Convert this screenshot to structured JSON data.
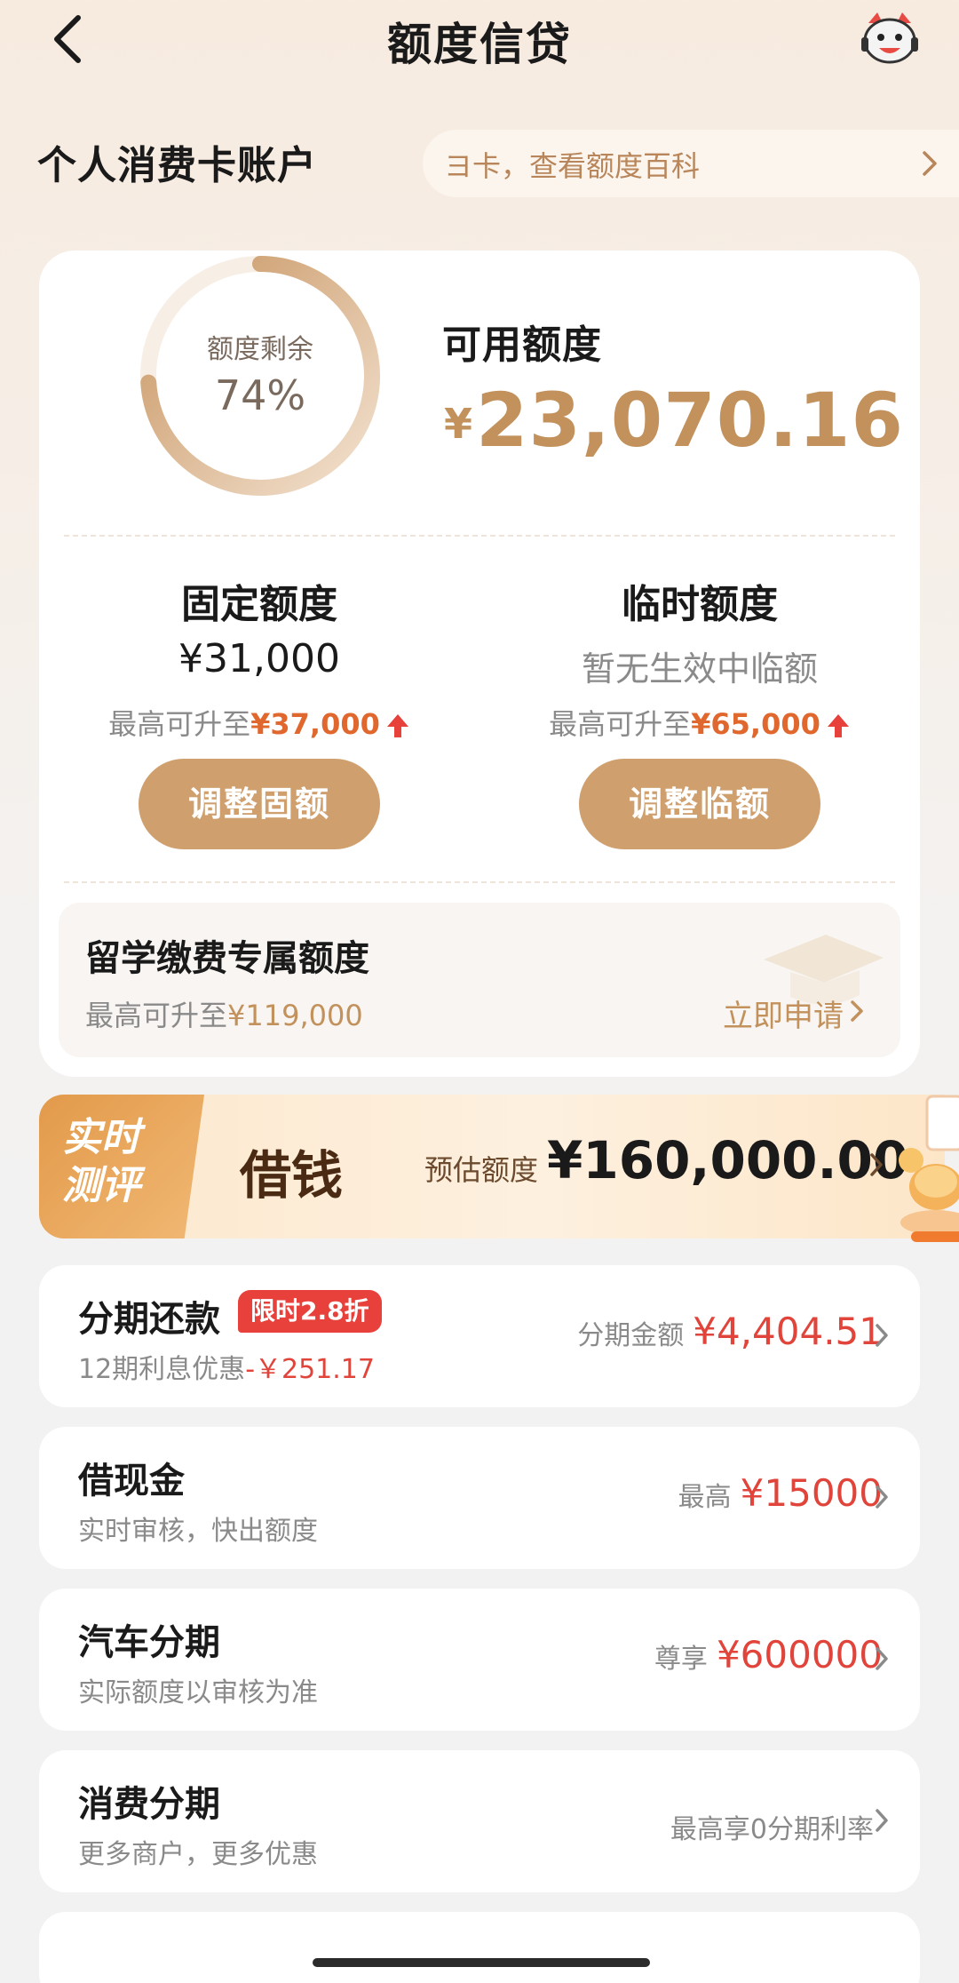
{
  "header": {
    "title": "额度信贷"
  },
  "account": {
    "title": "个人消费卡账户",
    "notice": "ヨ卡，查看额度百科"
  },
  "summary": {
    "ring_label": "额度剩余",
    "ring_value": "74%",
    "ring_fraction": 0.74,
    "avail_label": "可用额度",
    "avail_currency": "¥",
    "avail_amount": "23,070.16"
  },
  "fixed": {
    "title": "固定额度",
    "value": "¥31,000",
    "sub_prefix": "最高可升至",
    "sub_value": "¥37,000",
    "button": "调整固额"
  },
  "temp": {
    "title": "临时额度",
    "value": "暂无生效中临额",
    "sub_prefix": "最高可升至",
    "sub_value": "¥65,000",
    "button": "调整临额"
  },
  "study": {
    "title": "留学缴费专属额度",
    "sub_prefix": "最高可升至",
    "sub_value": "¥119,000",
    "apply": "立即申请"
  },
  "borrow": {
    "badge_line1": "实时",
    "badge_line2": "测评",
    "title": "借钱",
    "est_label": "预估额度",
    "est_value": "¥160,000.00"
  },
  "list": [
    {
      "title": "分期还款",
      "badge": "限时2.8折",
      "sub": "12期利息优惠",
      "sub_red": "-￥251.17",
      "right_label": "分期金额",
      "right_amount": "¥4,404.51"
    },
    {
      "title": "借现金",
      "sub": "实时审核，快出额度",
      "right_label": "最高",
      "right_amount": "¥15000"
    },
    {
      "title": "汽车分期",
      "sub": "实际额度以审核为准",
      "right_label": "尊享",
      "right_amount": "¥600000"
    },
    {
      "title": "消费分期",
      "sub": "更多商户，更多优惠",
      "right_label": "最高享0分期利率",
      "right_amount": ""
    }
  ],
  "colors": {
    "gold": "#c2915c",
    "button": "#cf9f6e",
    "red": "#e0443a",
    "orange": "#e0682e"
  }
}
